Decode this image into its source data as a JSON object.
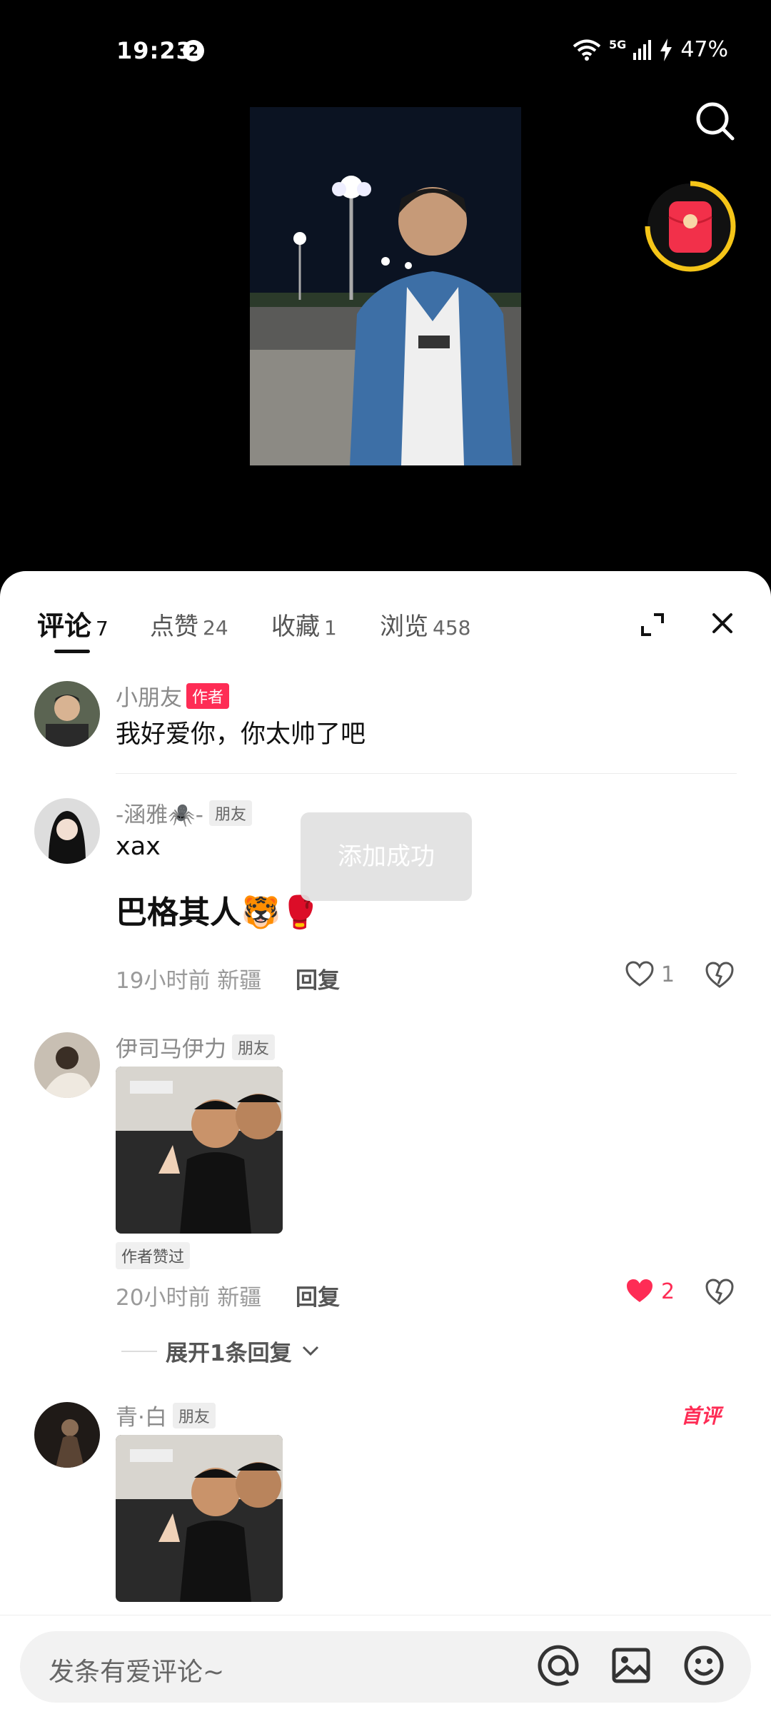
{
  "status": {
    "time": "19:23",
    "notification_count": "2",
    "network": "5G",
    "battery": "47%"
  },
  "tabs": [
    {
      "label": "评论",
      "count": "7"
    },
    {
      "label": "点赞",
      "count": "24"
    },
    {
      "label": "收藏",
      "count": "1"
    },
    {
      "label": "浏览",
      "count": "458"
    }
  ],
  "comments": [
    {
      "username": "小朋友",
      "badge": "作者",
      "text": "我好爱你，你太帅了吧"
    },
    {
      "username": "-涵雅🕷️-",
      "badge": "朋友",
      "text": "xax",
      "text2": "巴格其人🐯🥊",
      "meta": "19小时前 新疆",
      "reply": "回复",
      "likes": "1"
    },
    {
      "username": "伊司马伊力",
      "badge": "朋友",
      "liked_tag": "作者赞过",
      "meta": "20小时前 新疆",
      "reply": "回复",
      "likes": "2",
      "expand": "展开1条回复"
    },
    {
      "username": "青·白",
      "badge": "朋友",
      "first_tag": "首评"
    }
  ],
  "toast": "添加成功",
  "input": {
    "placeholder": "发条有爱评论~"
  },
  "colors": {
    "accent": "#fe2c55",
    "sheet": "#ffffff",
    "background": "#000000"
  },
  "icons": [
    "search-icon",
    "red-packet-icon",
    "expand-icon",
    "close-icon",
    "heart-icon",
    "dislike-heart-icon",
    "chevron-down-icon",
    "at-icon",
    "image-icon",
    "emoji-icon"
  ]
}
